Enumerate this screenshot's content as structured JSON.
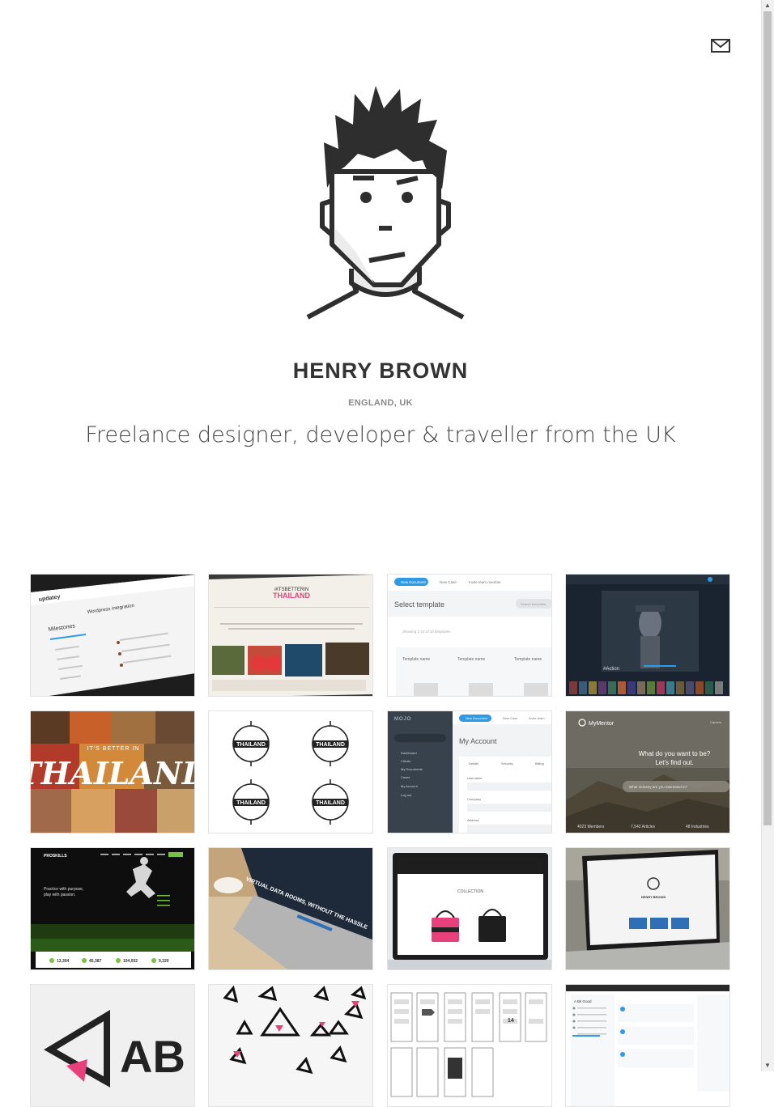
{
  "header": {
    "mail_icon": "envelope-icon"
  },
  "profile": {
    "name": "HENRY BROWN",
    "location": "ENGLAND, UK",
    "tagline": "Freelance designer, developer & traveller from the UK"
  },
  "portfolio": {
    "tiles": [
      {
        "id": "updatey",
        "labels": [
          "updatey",
          "Milestones",
          "Wordpress integration"
        ]
      },
      {
        "id": "its-better-in-thailand-site",
        "labels": [
          "#ITSBETTERIN",
          "THAILAND"
        ]
      },
      {
        "id": "select-template",
        "labels": [
          "New Document",
          "New Case",
          "Invite team member",
          "Select template",
          "Search templates",
          "Showing 1-10 of 10 templates",
          "Template name",
          "Template name",
          "Template name"
        ]
      },
      {
        "id": "action-streaming",
        "labels": [
          "#Action"
        ]
      },
      {
        "id": "thailand-collage",
        "labels": [
          "IT'S BETTER IN",
          "THAILAND"
        ]
      },
      {
        "id": "thailand-badges",
        "labels": [
          "THAILAND",
          "THAILAND",
          "THAILAND",
          "THAILAND"
        ]
      },
      {
        "id": "mojo-account",
        "labels": [
          "MOJO",
          "New Document",
          "New Case",
          "Invite team",
          "My Account",
          "Dashboard",
          "Clients",
          "My Documents",
          "Cases",
          "My Account",
          "Log out",
          "Details",
          "Security",
          "Billing",
          "Username",
          "Company",
          "Address"
        ]
      },
      {
        "id": "mymentor",
        "labels": [
          "MyMentor",
          "Careers",
          "What do you want to be?",
          "Let's find out.",
          "What industry are you interested in?",
          "4023 Members",
          "7,542 Articles",
          "48 Industries"
        ]
      },
      {
        "id": "proskills",
        "labels": [
          "PROSKILLS",
          "Practice with purpose,",
          "play with passion.",
          "13,304",
          "45,387",
          "104,932",
          "9,320"
        ]
      },
      {
        "id": "data-rooms",
        "labels": [
          "VIRTUAL DATA ROOMS, WITHOUT THE HASSLE"
        ]
      },
      {
        "id": "bag-shop",
        "labels": [
          "COLLECTION"
        ]
      },
      {
        "id": "henry-portfolio-laptop",
        "labels": [
          "HENRY BROWN"
        ]
      },
      {
        "id": "ab-logo",
        "labels": [
          "AB"
        ]
      },
      {
        "id": "triangle-pattern",
        "labels": []
      },
      {
        "id": "wireframes",
        "labels": [
          "14"
        ]
      },
      {
        "id": "updatey-dashboard",
        "labels": [
          "A Bit Good"
        ]
      }
    ]
  },
  "colors": {
    "accent_blue": "#2f9be6",
    "dark_ink": "#2e2e2e",
    "muted": "#8a8a8a",
    "pink": "#e8407a",
    "red": "#e83a3a"
  }
}
